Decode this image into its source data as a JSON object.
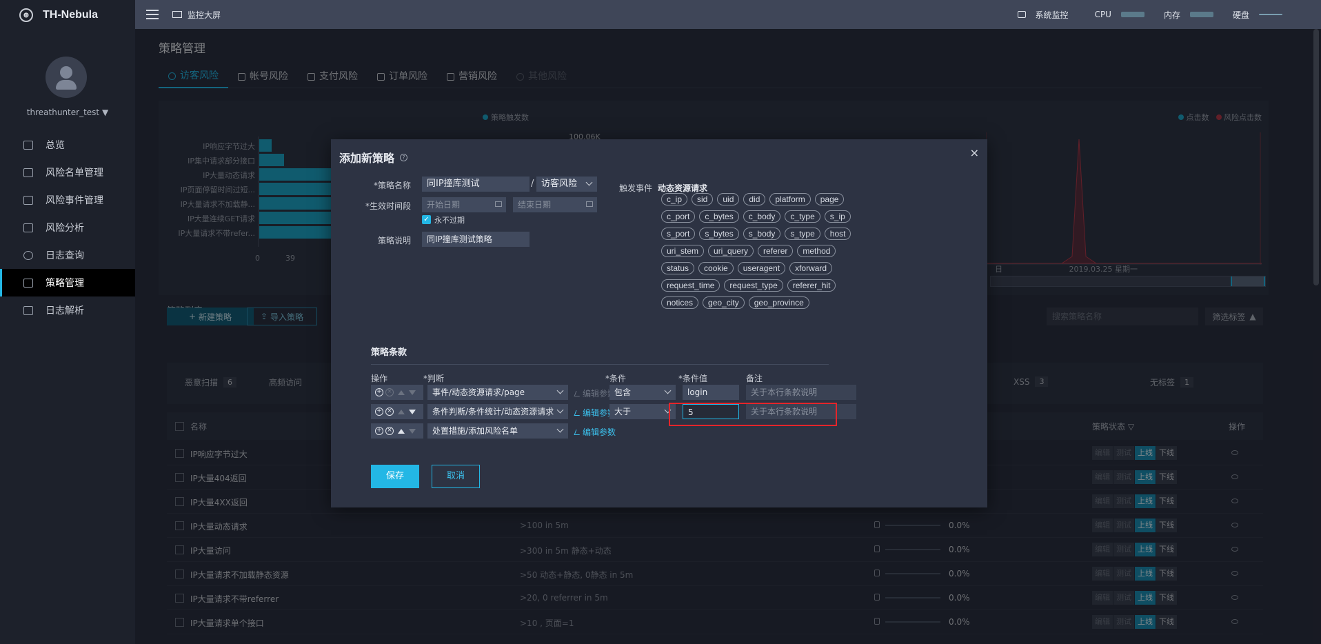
{
  "app": {
    "logo": "TH-Nebula"
  },
  "topbar": {
    "monitor_label": "监控大屏",
    "system_label": "系统监控",
    "cpu_label": "CPU",
    "mem_label": "内存",
    "disk_label": "硬盘"
  },
  "sidebar": {
    "username": "threathunter_test",
    "items": [
      {
        "label": "总览"
      },
      {
        "label": "风险名单管理"
      },
      {
        "label": "风险事件管理"
      },
      {
        "label": "风险分析"
      },
      {
        "label": "日志查询"
      },
      {
        "label": "策略管理"
      },
      {
        "label": "日志解析"
      }
    ]
  },
  "page": {
    "title": "策略管理",
    "tabs": [
      {
        "label": "访客风险"
      },
      {
        "label": "帐号风险"
      },
      {
        "label": "支付风险"
      },
      {
        "label": "订单风险"
      },
      {
        "label": "营销风险"
      },
      {
        "label": "其他风险"
      }
    ]
  },
  "chart": {
    "legend_left": "策略触发数",
    "legend_right_1": "点击数",
    "legend_right_2": "风险点击数",
    "top_value": "100.06K",
    "date_1": "日",
    "date_2": "2019.03.25 星期一",
    "tick_0": "0",
    "tick_1": "39",
    "bar_color": "#1ea6c9",
    "bar_labels": [
      "IP响应字节过大",
      "IP集中请求部分接口",
      "IP大量动态请求",
      "IP页面停留时间过短...",
      "IP大量请求不加载静...",
      "IP大量连续GET请求",
      "IP大量请求不带refer..."
    ],
    "bar_values": [
      6,
      12,
      100,
      100,
      100,
      100,
      100
    ]
  },
  "list": {
    "title": "策略列表",
    "new_button": "新建策略",
    "import_button": "导入策略",
    "search_placeholder": "搜索策略名称",
    "filter_button": "筛选标签",
    "tags": [
      {
        "label": "恶意扫描",
        "count": "6"
      },
      {
        "label": "高频访问",
        "count": ""
      },
      {
        "label": "XSS",
        "count": "3"
      },
      {
        "label": "无标签",
        "count": "1"
      }
    ],
    "col_name": "名称",
    "col_status": "策略状态",
    "col_action": "操作",
    "state_edit": "编辑",
    "state_test": "测试",
    "state_online": "上线",
    "state_offline": "下线",
    "rows": [
      {
        "name": "IP响应字节过大",
        "desc": "",
        "pct": ""
      },
      {
        "name": "IP大量404返回",
        "desc": "",
        "pct": ""
      },
      {
        "name": "IP大量4XX返回",
        "desc": "",
        "pct": ""
      },
      {
        "name": "IP大量动态请求",
        "desc": ">100 in 5m",
        "pct": "0.0%"
      },
      {
        "name": "IP大量访问",
        "desc": ">300 in 5m 静态+动态",
        "pct": "0.0%"
      },
      {
        "name": "IP大量请求不加载静态资源",
        "desc": ">50 动态+静态, 0静态 in 5m",
        "pct": "0.0%"
      },
      {
        "name": "IP大量请求不带referrer",
        "desc": ">20, 0 referrer in 5m",
        "pct": "0.0%"
      },
      {
        "name": "IP大量请求单个接口",
        "desc": ">10 , 页面=1",
        "pct": "0.0%"
      }
    ]
  },
  "modal": {
    "title": "添加新策略",
    "name_label": "*策略名称",
    "name_value": "同IP撞库测试",
    "category_value": "访客风险",
    "time_label": "*生效时间段",
    "start_placeholder": "开始日期",
    "end_placeholder": "结束日期",
    "never_expire": "永不过期",
    "desc_label": "策略说明",
    "desc_value": "同IP撞库测试策略",
    "trigger_label": "触发事件",
    "trigger_value": "动态资源请求",
    "fields": [
      "c_ip",
      "sid",
      "uid",
      "did",
      "platform",
      "page",
      "c_port",
      "c_bytes",
      "c_body",
      "c_type",
      "s_ip",
      "s_port",
      "s_bytes",
      "s_body",
      "s_type",
      "host",
      "uri_stem",
      "uri_query",
      "referer",
      "method",
      "status",
      "cookie",
      "useragent",
      "xforward",
      "request_time",
      "request_type",
      "referer_hit",
      "notices",
      "geo_city",
      "geo_province"
    ],
    "section_title": "策略条款",
    "col_op": "操作",
    "col_judge": "*判断",
    "col_cond": "*条件",
    "col_value": "*条件值",
    "col_note": "备注",
    "clauses": [
      {
        "judge": "事件/动态资源请求/page",
        "edit": "编辑参数",
        "cond": "包含",
        "value": "login",
        "note": "关于本行条款说明"
      },
      {
        "judge": "条件判断/条件统计/动态资源请求",
        "edit": "编辑参数",
        "cond": "大于",
        "value": "5",
        "note": "关于本行条款说明"
      },
      {
        "judge": "处置措施/添加风险名单",
        "edit": "编辑参数"
      }
    ],
    "save": "保存",
    "cancel": "取消",
    "close": "×"
  }
}
